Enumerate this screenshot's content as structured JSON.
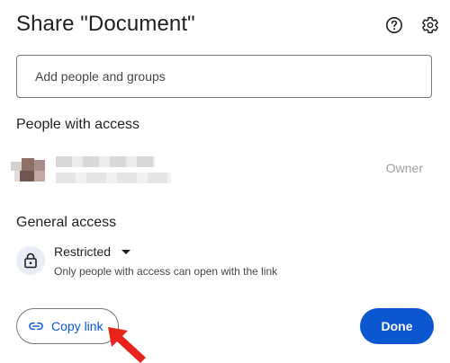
{
  "dialog": {
    "title": "Share \"Document\"",
    "help_icon": "help-circle-icon",
    "settings_icon": "gear-icon"
  },
  "add_people": {
    "placeholder": "Add people and groups"
  },
  "people_with_access": {
    "heading": "People with access",
    "people": [
      {
        "name": "",
        "email": "",
        "role": "Owner"
      }
    ]
  },
  "general_access": {
    "heading": "General access",
    "icon": "lock-icon",
    "selected": "Restricted",
    "description": "Only people with access can open with the link"
  },
  "footer": {
    "copy_link_label": "Copy link",
    "copy_link_icon": "link-icon",
    "done_label": "Done"
  },
  "colors": {
    "accent": "#0b57d0",
    "annotation_arrow": "#e8231b"
  }
}
